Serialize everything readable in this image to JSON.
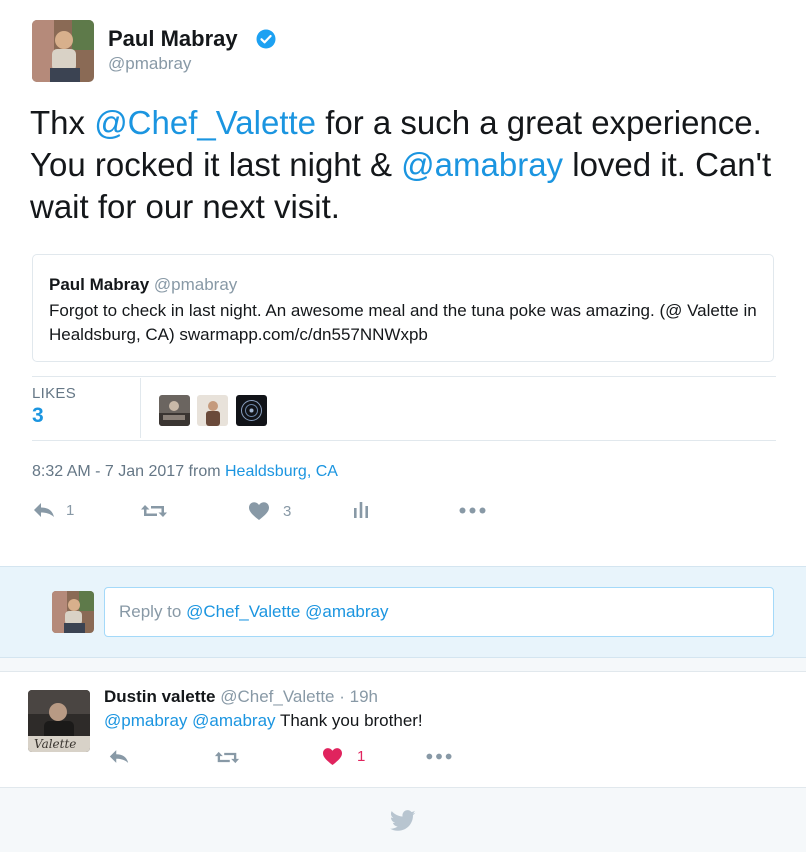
{
  "tweet": {
    "author_name": "Paul Mabray",
    "author_handle": "@pmabray",
    "text_parts": {
      "p1": "Thx ",
      "m1": "@Chef_Valette",
      "p2": " for a such a great experience. You rocked it last night & ",
      "m2": "@amabray",
      "p3": " loved it. Can't wait for our next visit."
    },
    "quote": {
      "name": "Paul Mabray",
      "handle": "@pmabray",
      "text": "Forgot to check in last night. An awesome meal and the tuna poke was amazing. (@ Valette in Healdsburg, CA) swarmapp.com/c/dn557NNWxpb"
    },
    "likes_label": "LIKES",
    "likes_count": "3",
    "timestamp": "8:32 AM - 7 Jan 2017 from ",
    "location": "Healdsburg, CA",
    "actions": {
      "reply_count": "1",
      "like_count": "3"
    }
  },
  "reply_box": {
    "prefix": "Reply to ",
    "mentions": "@Chef_Valette @amabray"
  },
  "reply_tweet": {
    "author_name": "Dustin valette",
    "author_handle": "@Chef_Valette",
    "separator": " · ",
    "time": "19h",
    "mention1": "@pmabray",
    "mention2": "@amabray",
    "text": " Thank you brother!",
    "like_count": "1"
  },
  "colors": {
    "link": "#1b95e0",
    "muted": "#8899a6",
    "liked": "#e0245e",
    "reply_bar_bg": "#e8f4fb"
  },
  "icons": [
    "verified-badge-icon",
    "reply-icon",
    "retweet-icon",
    "heart-icon",
    "analytics-icon",
    "more-icon",
    "twitter-bird-icon"
  ]
}
